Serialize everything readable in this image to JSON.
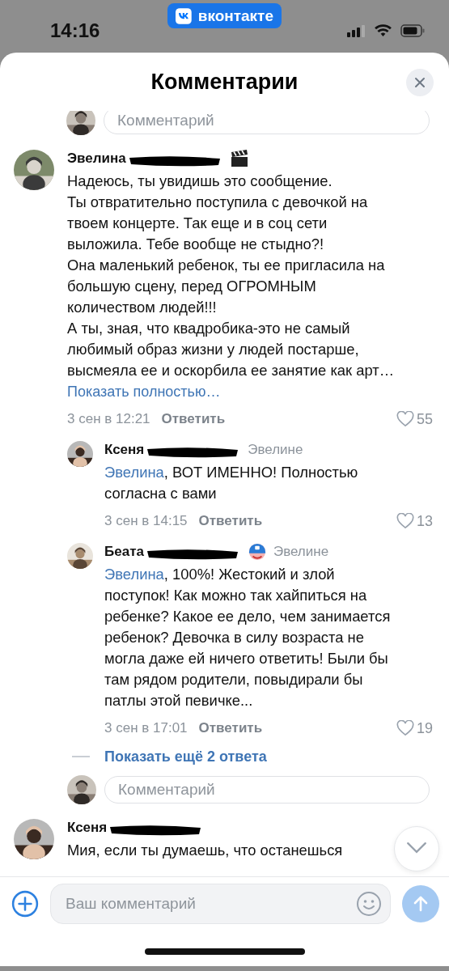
{
  "status_bar": {
    "time": "14:16",
    "app_badge": "вконтакте"
  },
  "sheet": {
    "title": "Комментарии"
  },
  "top_reply_field": {
    "placeholder": "Комментарий"
  },
  "comments": [
    {
      "author": "Эвелина",
      "redacted": true,
      "badge": {
        "kind": "clapperboard"
      },
      "text": "Надеюсь, ты увидишь это сообщение.\nТы отвратительно поступила с девочкой на\nтвоем концерте. Так еще и в соц сети\nвыложила. Тебе вообще не стыдно?!\nОна маленький ребенок, ты ее пригласила на\nбольшую сцену, перед ОГРОМНЫМ\nколичеством людей!!!\nА ты, зная, что квадробика-это не самый\nлюбимый образ жизни у людей постарше,\nвысмеяла ее и оскорбила ее занятие как арт…",
      "show_more": "Показать полностью…",
      "date": "3 сен в 12:21",
      "reply": "Ответить",
      "likes": "55",
      "replies": [
        {
          "author": "Ксеня",
          "redacted": true,
          "reply_to": "Эвелине",
          "mention": "Эвелина",
          "text": ", ВОТ ИМЕННО! Полностью\nсогласна с вами",
          "date": "3 сен в 14:15",
          "reply": "Ответить",
          "likes": "13"
        },
        {
          "author": "Беата",
          "redacted": true,
          "badge": {
            "kind": "mask"
          },
          "reply_to": "Эвелине",
          "mention": "Эвелина",
          "text": ", 100%! Жестокий и злой\nпоступок! Как можно так хайпиться на\nребенке? Какое ее дело, чем занимается\nребенок? Девочка в силу возраста не\nмогла даже ей ничего ответить! Были бы\nтам рядом родители, повыдирали бы\nпатлы этой певичке...",
          "date": "3 сен в 17:01",
          "reply": "Ответить",
          "likes": "19"
        }
      ],
      "more_replies": "Показать ещё 2 ответа",
      "reply_field": {
        "placeholder": "Комментарий"
      }
    },
    {
      "author": "Ксеня",
      "redacted": true,
      "text": "Мия, если ты думаешь, что останешься"
    }
  ],
  "composer": {
    "placeholder": "Ваш комментарий"
  }
}
